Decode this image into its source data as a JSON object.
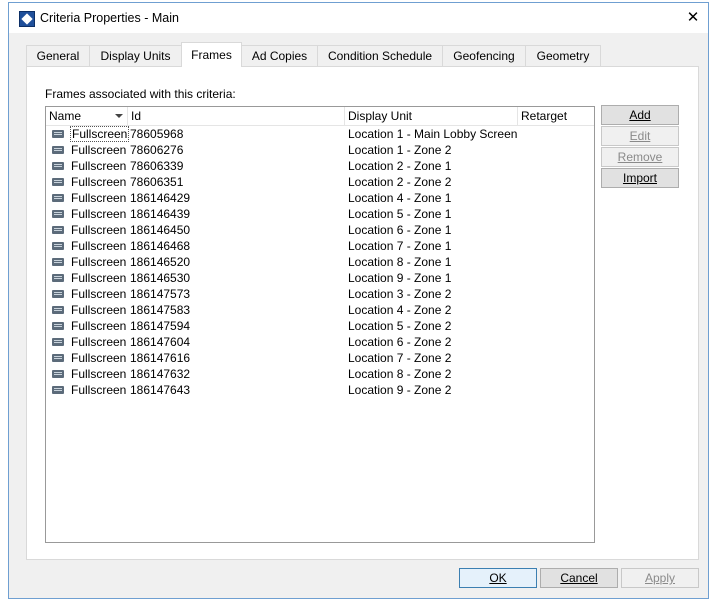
{
  "window": {
    "title": "Criteria Properties - Main",
    "close_glyph": "✕"
  },
  "tabs": [
    {
      "label": "General"
    },
    {
      "label": "Display Units"
    },
    {
      "label": "Frames"
    },
    {
      "label": "Ad Copies"
    },
    {
      "label": "Condition Schedule"
    },
    {
      "label": "Geofencing"
    },
    {
      "label": "Geometry"
    }
  ],
  "active_tab": "Frames",
  "frames": {
    "label": "Frames associated with this criteria:",
    "columns": {
      "name": "Name",
      "id": "Id",
      "display_unit": "Display Unit",
      "retarget": "Retarget"
    },
    "rows": [
      {
        "name": "Fullscreen",
        "id": "78605968",
        "display_unit": "Location 1 - Main Lobby Screen",
        "retarget": ""
      },
      {
        "name": "Fullscreen",
        "id": "78606276",
        "display_unit": "Location 1 - Zone 2",
        "retarget": ""
      },
      {
        "name": "Fullscreen",
        "id": "78606339",
        "display_unit": "Location 2 - Zone 1",
        "retarget": ""
      },
      {
        "name": "Fullscreen",
        "id": "78606351",
        "display_unit": "Location 2 - Zone 2",
        "retarget": ""
      },
      {
        "name": "Fullscreen",
        "id": "186146429",
        "display_unit": "Location 4 - Zone 1",
        "retarget": ""
      },
      {
        "name": "Fullscreen",
        "id": "186146439",
        "display_unit": "Location 5 - Zone 1",
        "retarget": ""
      },
      {
        "name": "Fullscreen",
        "id": "186146450",
        "display_unit": "Location 6 - Zone 1",
        "retarget": ""
      },
      {
        "name": "Fullscreen",
        "id": "186146468",
        "display_unit": "Location 7 - Zone 1",
        "retarget": ""
      },
      {
        "name": "Fullscreen",
        "id": "186146520",
        "display_unit": "Location 8 - Zone 1",
        "retarget": ""
      },
      {
        "name": "Fullscreen",
        "id": "186146530",
        "display_unit": "Location 9 - Zone 1",
        "retarget": ""
      },
      {
        "name": "Fullscreen",
        "id": "186147573",
        "display_unit": "Location 3 - Zone 2",
        "retarget": ""
      },
      {
        "name": "Fullscreen",
        "id": "186147583",
        "display_unit": "Location 4 - Zone 2",
        "retarget": ""
      },
      {
        "name": "Fullscreen",
        "id": "186147594",
        "display_unit": "Location 5 - Zone 2",
        "retarget": ""
      },
      {
        "name": "Fullscreen",
        "id": "186147604",
        "display_unit": "Location 6 - Zone 2",
        "retarget": ""
      },
      {
        "name": "Fullscreen",
        "id": "186147616",
        "display_unit": "Location 7 - Zone 2",
        "retarget": ""
      },
      {
        "name": "Fullscreen",
        "id": "186147632",
        "display_unit": "Location 8 - Zone 2",
        "retarget": ""
      },
      {
        "name": "Fullscreen",
        "id": "186147643",
        "display_unit": "Location 9 - Zone 2",
        "retarget": ""
      }
    ]
  },
  "side_buttons": {
    "add": {
      "label": "Add",
      "enabled": true
    },
    "edit": {
      "label": "Edit",
      "enabled": false
    },
    "remove": {
      "label": "Remove",
      "enabled": false
    },
    "import": {
      "label": "Import",
      "enabled": true
    }
  },
  "footer_buttons": {
    "ok": {
      "label": "OK",
      "enabled": true
    },
    "cancel": {
      "label": "Cancel",
      "enabled": true
    },
    "apply": {
      "label": "Apply",
      "enabled": false
    }
  },
  "colors": {
    "accent_border": "#6f9fd1",
    "default_button": "#3c7fb1"
  }
}
